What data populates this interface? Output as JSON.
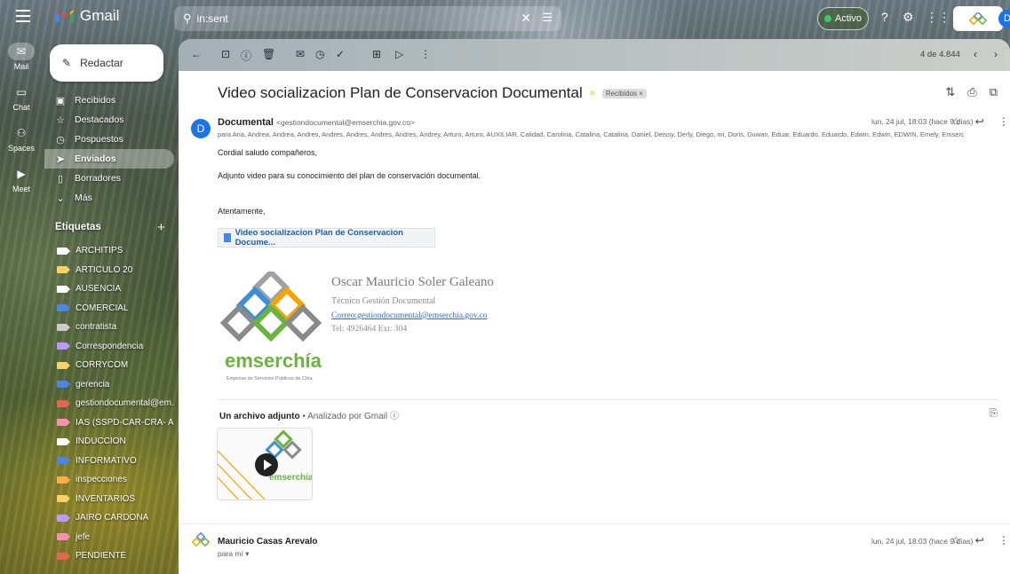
{
  "app": {
    "name": "Gmail"
  },
  "search": {
    "value": "in:sent"
  },
  "status": {
    "label": "Activo"
  },
  "account": {
    "initial": "D"
  },
  "rail": [
    {
      "label": "Mail"
    },
    {
      "label": "Chat"
    },
    {
      "label": "Spaces"
    },
    {
      "label": "Meet"
    }
  ],
  "compose": {
    "label": "Redactar"
  },
  "nav": [
    {
      "label": "Recibidos",
      "icon": "inbox-icon"
    },
    {
      "label": "Destacados",
      "icon": "star-icon"
    },
    {
      "label": "Pospuestos",
      "icon": "clock-icon"
    },
    {
      "label": "Enviados",
      "icon": "send-icon"
    },
    {
      "label": "Borradores",
      "icon": "draft-icon"
    },
    {
      "label": "Más",
      "icon": "chevron-down-icon"
    }
  ],
  "labels": {
    "header": "Etiquetas",
    "items": [
      {
        "label": "ARCHITIPS",
        "color": "#ffffff"
      },
      {
        "label": "ARTICULO 20",
        "color": "#fad165"
      },
      {
        "label": "AUSENCIA",
        "color": "#ffffff"
      },
      {
        "label": "COMERCIAL",
        "color": "#4a86e8"
      },
      {
        "label": "contratista",
        "color": "#cccccc"
      },
      {
        "label": "Correspondencia",
        "color": "#b99aff"
      },
      {
        "label": "CORRYCOM",
        "color": "#fad165"
      },
      {
        "label": "gerencia",
        "color": "#4a86e8"
      },
      {
        "label": "gestiondocumental@em...",
        "color": "#e66550"
      },
      {
        "label": "IAS (SSPD-CAR-CRA- A...",
        "color": "#f691b3"
      },
      {
        "label": "INDUCCION",
        "color": "#ffffff"
      },
      {
        "label": "INFORMATIVO",
        "color": "#4a86e8"
      },
      {
        "label": "inspecciones",
        "color": "#ffad47"
      },
      {
        "label": "INVENTARIOS",
        "color": "#fad165"
      },
      {
        "label": "JAIRO CARDONA",
        "color": "#b99aff"
      },
      {
        "label": "jefe",
        "color": "#f691b3"
      },
      {
        "label": "PENDIENTE",
        "color": "#e66550"
      }
    ]
  },
  "toolbar": {
    "pager": "4 de 4.844"
  },
  "email": {
    "subject": "Video socializacion Plan de Conservacion Documental",
    "chip": "Recibidos ×",
    "sender_name": "Documental",
    "sender_addr": "<gestiondocumental@emserchia.gov.co>",
    "avatar_initial": "D",
    "recipients": "para Ana, Andrea, Andrea, Andres, Andres, Andres, Andres, Andres, Andrey, Arturo, Arturo, AUXILIAR, Calidad, Carolina, Catalina, Catalina, Daniel, Deissy, Derly, Diego, mi, Doris, Duwan, Eduar, Eduardo, Eduardo, Edwin, Edwin, EDWIN, Emely, Emserchi ▾",
    "date": "lun, 24 jul, 18:03 (hace 9 días)",
    "greeting": "Cordial saludo compañeros,",
    "body": "Adjunto video para su conocimiento del plan de conservación documental.",
    "closing": "Atentamente,",
    "drive_link": "Video socializacion Plan de Conservacion Docume...",
    "signature": {
      "name": "Oscar Mauricio Soler Galeano",
      "role": "Técnico Gestión Documental",
      "mail": "Correo:gestiondocumental@emserchia.gov.co",
      "tel": "Tel: 4926464 Ext: 304",
      "brand": "emserchía",
      "brand_tagline": "Empresa de Servicios Públicos de Chía"
    },
    "attachments_title": "Un archivo adjunto",
    "attachments_scan": "• Analizado por Gmail ⓘ",
    "thumb_brand": "emserchia"
  },
  "email2": {
    "sender_name": "Mauricio Casas Arevalo",
    "to": "para mí ▾",
    "date": "lun, 24 jul, 18:03 (hace 9 días)"
  }
}
